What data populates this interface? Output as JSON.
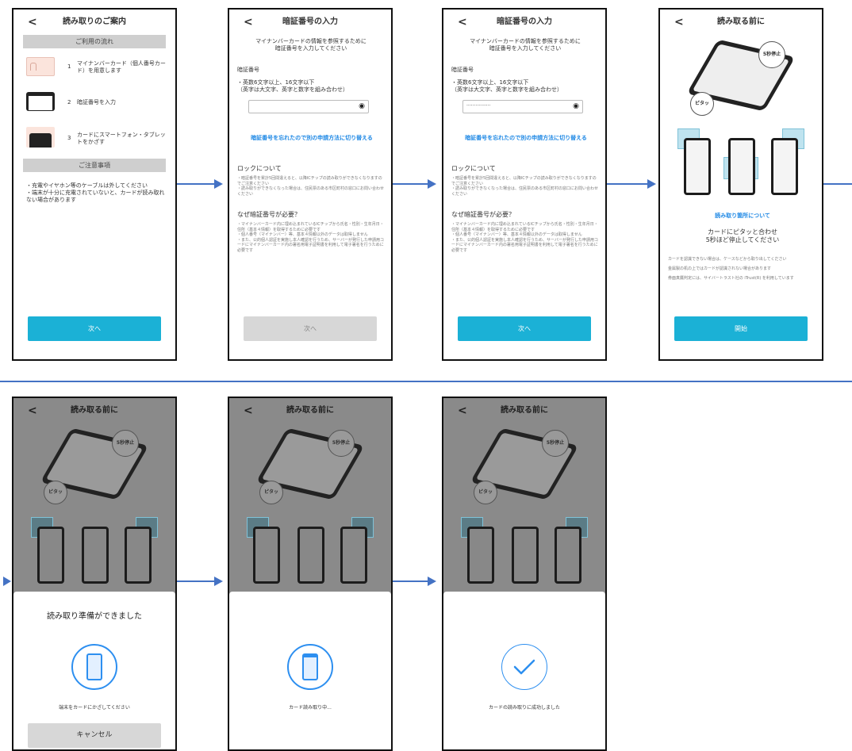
{
  "screen1": {
    "title": "読み取りのご案内",
    "flow_header": "ご利用の流れ",
    "step1_num": "1",
    "step1_text": "マイナンバーカード（個人番号カード）を用意します",
    "step2_num": "2",
    "step2_text": "暗証番号を入力",
    "step3_num": "3",
    "step3_text": "カードにスマートフォン・タブレットをかざす",
    "notes_header": "ご注意事項",
    "notes": "・充電やイヤホン等のケーブルは外してください\n・端末が十分に充電されていないと、カードが読み取れない場合があります",
    "next_label": "次へ"
  },
  "pin": {
    "title": "暗証番号の入力",
    "intro": "マイナンバーカードの情報を参照するために\n暗証番号を入力してください",
    "field_label": "暗証番号",
    "rule": "・英数6文字以上、16文字以下\n（英字は大文字、英字と数字を組み合わせ）",
    "masked_value": "················",
    "forgot_link": "暗証番号を忘れたので別の申請方法に切り替える",
    "lock_heading": "ロックについて",
    "lock_text": "・暗証番号を累計5回間違えると、以降ICチップの読み取りができなくなりますのでご注意ください\n・読み取りができなくなった場合は、住民票のある市区町村の窓口にお問い合わせください",
    "why_heading": "なぜ暗証番号が必要？",
    "why_text": "・マイナンバーカード内に埋め込まれているICチップから氏名・性別・生年月日・住所（基本４情報）を取得するために必要です\n・個人番号（マイナンバー）等、基本４情報以外のデータは取得しません\n・また、公的個人認証を実施し本人確認を行うため、サーバーが発行した申請用コードにマイナンバーカード内の署名用電子証明書を利用して電子署名を行うために必要です",
    "next_label": "次へ"
  },
  "before": {
    "title": "読み取る前に",
    "badge_top": "5秒停止",
    "badge_left": "ピタッ",
    "location_link": "読み取り箇所について",
    "instruction": "カードにピタッと合わせ\n5秒ほど停止してください",
    "note1": "カードを認識できない場合は、ケースなどから取り出してください",
    "note2": "金属製の机の上ではカードが認識されない場合があります",
    "note3": "券面真贋判定には、サイバートラスト社の iTrust(R) を利用しています",
    "start_label": "開始"
  },
  "sheet1": {
    "title": "読み取り準備ができました",
    "message": "端末をカードにかざしてください",
    "cancel_label": "キャンセル"
  },
  "sheet2": {
    "message": "カード読み取り中..."
  },
  "sheet3": {
    "message": "カードの読み取りに成功しました"
  },
  "colors": {
    "accent": "#1bb1d6",
    "link": "#1e88e5",
    "arrow": "#4472c4"
  }
}
